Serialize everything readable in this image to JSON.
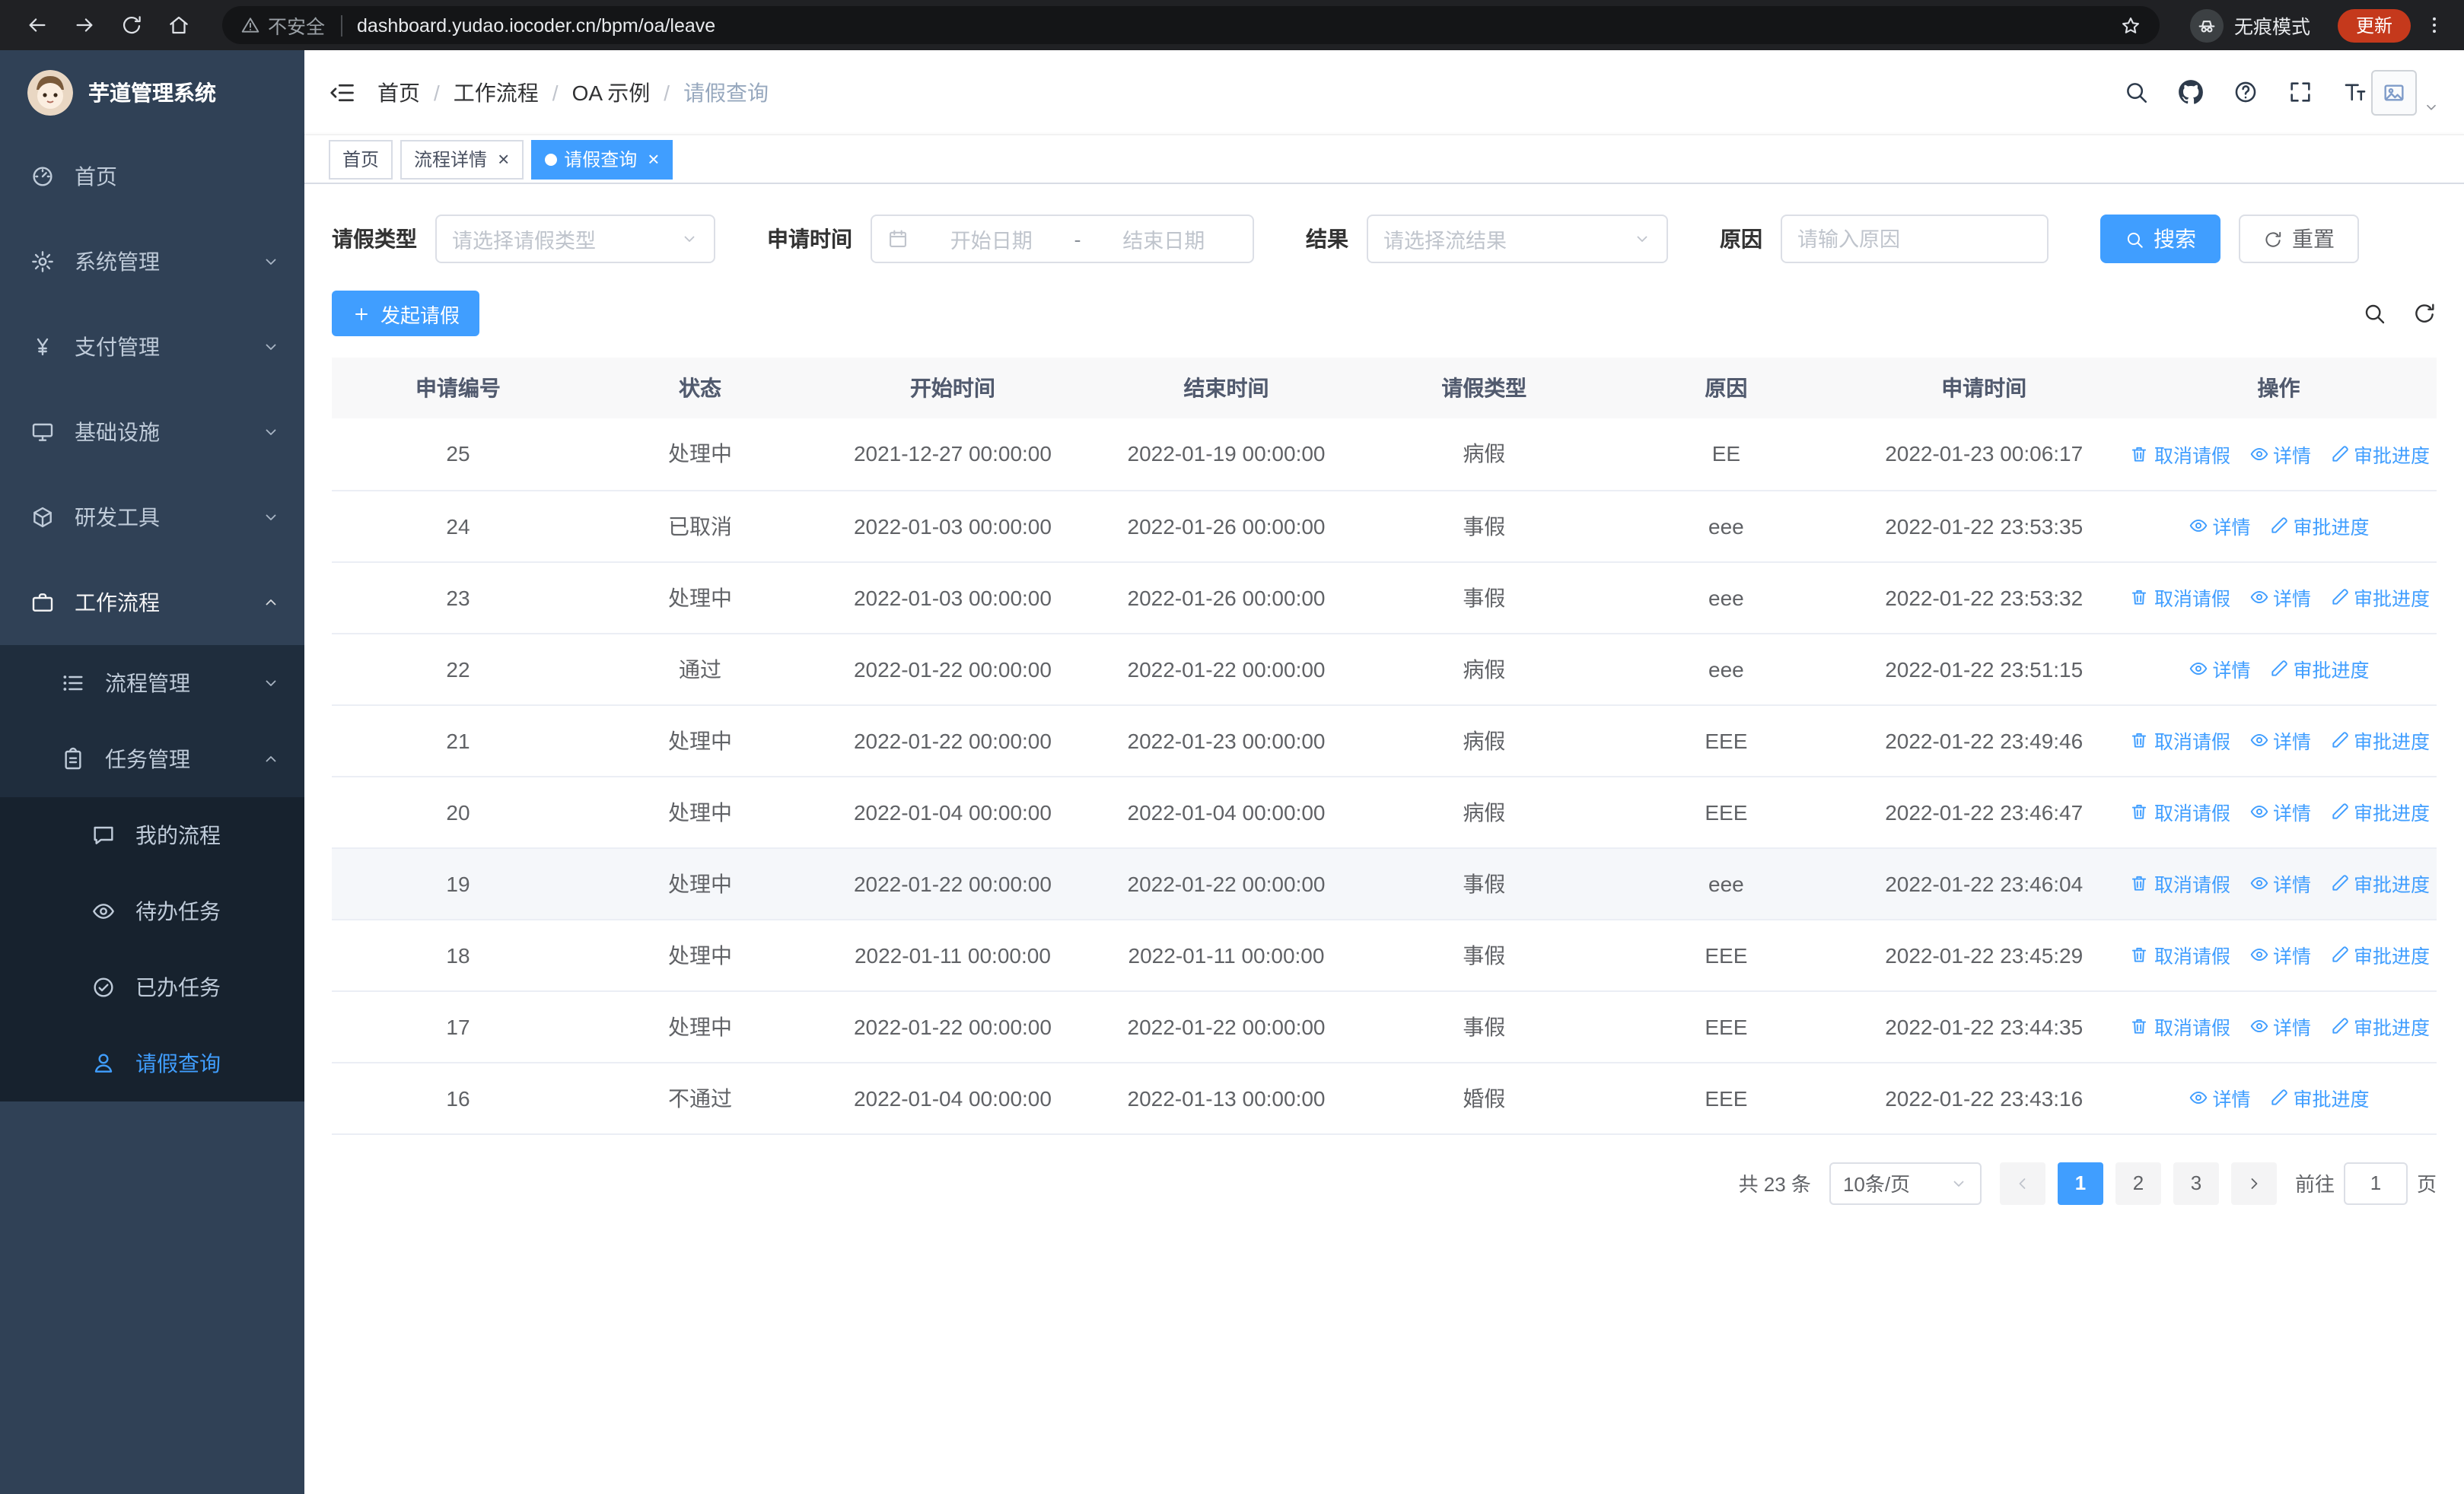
{
  "browser": {
    "security_warning": "不安全",
    "url": "dashboard.yudao.iocoder.cn/bpm/oa/leave",
    "incognito_label": "无痕模式",
    "update_button": "更新"
  },
  "sidebar": {
    "logo_title": "芋道管理系统",
    "items": [
      {
        "key": "home",
        "label": "首页",
        "icon": "dashboard-icon"
      },
      {
        "key": "system",
        "label": "系统管理",
        "icon": "gear-icon",
        "expandable": true
      },
      {
        "key": "payment",
        "label": "支付管理",
        "icon": "yen-icon",
        "expandable": true
      },
      {
        "key": "infra",
        "label": "基础设施",
        "icon": "monitor-icon",
        "expandable": true
      },
      {
        "key": "devtools",
        "label": "研发工具",
        "icon": "cube-icon",
        "expandable": true
      },
      {
        "key": "workflow",
        "label": "工作流程",
        "icon": "briefcase-icon",
        "expandable": true,
        "expanded": true,
        "children": [
          {
            "key": "process-mgmt",
            "label": "流程管理",
            "icon": "list-icon",
            "expandable": true
          },
          {
            "key": "task-mgmt",
            "label": "任务管理",
            "icon": "clipboard-icon",
            "expandable": true,
            "expanded": true,
            "children": [
              {
                "key": "my-process",
                "label": "我的流程",
                "icon": "chat-icon"
              },
              {
                "key": "todo-task",
                "label": "待办任务",
                "icon": "eye-icon"
              },
              {
                "key": "done-task",
                "label": "已办任务",
                "icon": "check-circle-icon"
              },
              {
                "key": "leave-query",
                "label": "请假查询",
                "icon": "user-icon",
                "active": true
              }
            ]
          }
        ]
      }
    ]
  },
  "header": {
    "breadcrumb": [
      "首页",
      "工作流程",
      "OA 示例",
      "请假查询"
    ],
    "icons": [
      "search-icon",
      "github-icon",
      "question-icon",
      "fullscreen-icon",
      "font-size-icon"
    ]
  },
  "tabs": [
    {
      "key": "home",
      "label": "首页",
      "closable": false,
      "active": false
    },
    {
      "key": "process-detail",
      "label": "流程详情",
      "closable": true,
      "active": false
    },
    {
      "key": "leave-query",
      "label": "请假查询",
      "closable": true,
      "active": true
    }
  ],
  "filters": {
    "leave_type_label": "请假类型",
    "leave_type_placeholder": "请选择请假类型",
    "apply_time_label": "申请时间",
    "start_date_placeholder": "开始日期",
    "date_separator": "-",
    "end_date_placeholder": "结束日期",
    "result_label": "结果",
    "result_placeholder": "请选择流结果",
    "reason_label": "原因",
    "reason_placeholder": "请输入原因",
    "search_button": "搜索",
    "reset_button": "重置"
  },
  "toolbar": {
    "create_button": "发起请假"
  },
  "table": {
    "columns": [
      "申请编号",
      "状态",
      "开始时间",
      "结束时间",
      "请假类型",
      "原因",
      "申请时间",
      "操作"
    ],
    "action_defs": {
      "cancel": {
        "label": "取消请假",
        "icon": "trash-icon"
      },
      "detail": {
        "label": "详情",
        "icon": "eye-icon"
      },
      "progress": {
        "label": "审批进度",
        "icon": "edit-icon"
      }
    },
    "rows": [
      {
        "id": "25",
        "status": "处理中",
        "start": "2021-12-27 00:00:00",
        "end": "2022-01-19 00:00:00",
        "type": "病假",
        "reason": "EE",
        "apply_time": "2022-01-23 00:06:17",
        "actions": [
          "cancel",
          "detail",
          "progress"
        ]
      },
      {
        "id": "24",
        "status": "已取消",
        "start": "2022-01-03 00:00:00",
        "end": "2022-01-26 00:00:00",
        "type": "事假",
        "reason": "eee",
        "apply_time": "2022-01-22 23:53:35",
        "actions": [
          "detail",
          "progress"
        ]
      },
      {
        "id": "23",
        "status": "处理中",
        "start": "2022-01-03 00:00:00",
        "end": "2022-01-26 00:00:00",
        "type": "事假",
        "reason": "eee",
        "apply_time": "2022-01-22 23:53:32",
        "actions": [
          "cancel",
          "detail",
          "progress"
        ]
      },
      {
        "id": "22",
        "status": "通过",
        "start": "2022-01-22 00:00:00",
        "end": "2022-01-22 00:00:00",
        "type": "病假",
        "reason": "eee",
        "apply_time": "2022-01-22 23:51:15",
        "actions": [
          "detail",
          "progress"
        ]
      },
      {
        "id": "21",
        "status": "处理中",
        "start": "2022-01-22 00:00:00",
        "end": "2022-01-23 00:00:00",
        "type": "病假",
        "reason": "EEE",
        "apply_time": "2022-01-22 23:49:46",
        "actions": [
          "cancel",
          "detail",
          "progress"
        ]
      },
      {
        "id": "20",
        "status": "处理中",
        "start": "2022-01-04 00:00:00",
        "end": "2022-01-04 00:00:00",
        "type": "病假",
        "reason": "EEE",
        "apply_time": "2022-01-22 23:46:47",
        "actions": [
          "cancel",
          "detail",
          "progress"
        ]
      },
      {
        "id": "19",
        "status": "处理中",
        "start": "2022-01-22 00:00:00",
        "end": "2022-01-22 00:00:00",
        "type": "事假",
        "reason": "eee",
        "apply_time": "2022-01-22 23:46:04",
        "actions": [
          "cancel",
          "detail",
          "progress"
        ],
        "highlighted": true
      },
      {
        "id": "18",
        "status": "处理中",
        "start": "2022-01-11 00:00:00",
        "end": "2022-01-11 00:00:00",
        "type": "事假",
        "reason": "EEE",
        "apply_time": "2022-01-22 23:45:29",
        "actions": [
          "cancel",
          "detail",
          "progress"
        ]
      },
      {
        "id": "17",
        "status": "处理中",
        "start": "2022-01-22 00:00:00",
        "end": "2022-01-22 00:00:00",
        "type": "事假",
        "reason": "EEE",
        "apply_time": "2022-01-22 23:44:35",
        "actions": [
          "cancel",
          "detail",
          "progress"
        ]
      },
      {
        "id": "16",
        "status": "不通过",
        "start": "2022-01-04 00:00:00",
        "end": "2022-01-13 00:00:00",
        "type": "婚假",
        "reason": "EEE",
        "apply_time": "2022-01-22 23:43:16",
        "actions": [
          "detail",
          "progress"
        ]
      }
    ]
  },
  "pagination": {
    "total_text": "共 23 条",
    "page_size": "10条/页",
    "pages": [
      "1",
      "2",
      "3"
    ],
    "current_page": "1",
    "goto_label": "前往",
    "goto_value": "1",
    "page_label": "页"
  },
  "colors": {
    "primary": "#409eff",
    "sidebar_bg": "#304156",
    "submenu_bg": "#1f2d3d",
    "update_pill": "#c5391c"
  }
}
